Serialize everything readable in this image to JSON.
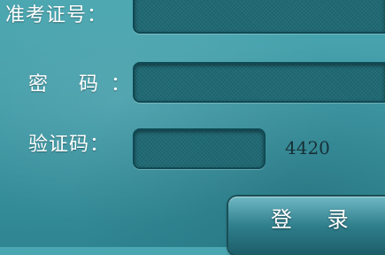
{
  "form": {
    "username_label": "准考证号：",
    "password_label": "密 码：",
    "captcha_label": "验证码：",
    "username_value": "",
    "password_value": "",
    "captcha_value": "",
    "captcha_code": "4420",
    "login_label": "登 录"
  },
  "colors": {
    "background": "#3f9aa6",
    "field": "#1f6974",
    "label": "#ffffff"
  }
}
